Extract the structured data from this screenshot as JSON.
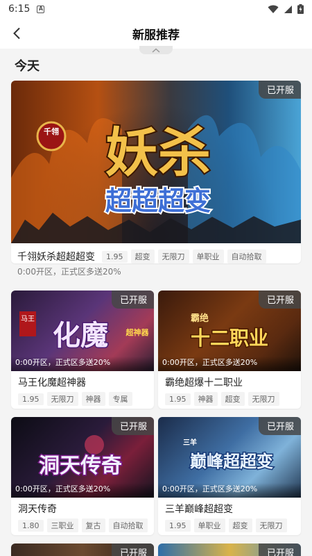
{
  "status": {
    "time": "6:15"
  },
  "header": {
    "title": "新服推荐"
  },
  "section": {
    "title": "今天"
  },
  "featured": {
    "name": "千翎妖杀超超超变",
    "badge": "已开服",
    "art_small": "千翎",
    "art_title": "妖杀",
    "art_subtitle": "超超超变",
    "tags": [
      "1.95",
      "超变",
      "无限刀",
      "单职业",
      "自动拾取"
    ],
    "subtext": "0:00开区，正式区多送20%"
  },
  "games": [
    {
      "name": "马王化魔超神器",
      "badge": "已开服",
      "overlay": "0:00开区，正式区多送20%",
      "art_left": "马王",
      "art_title": "化魔",
      "art_right": "超神器",
      "tags": [
        "1.95",
        "无限刀",
        "神器",
        "专属"
      ]
    },
    {
      "name": "霸绝超爆十二职业",
      "badge": "已开服",
      "overlay": "0:00开区，正式区多送20%",
      "art_left": "霸绝",
      "art_title": "十二职业",
      "art_right": "",
      "tags": [
        "1.95",
        "神器",
        "超变",
        "无限刀"
      ]
    },
    {
      "name": "洞天传奇",
      "badge": "已开服",
      "overlay": "0:00开区，正式区多送20%",
      "art_left": "",
      "art_title": "洞天传奇",
      "art_right": "",
      "tags": [
        "1.80",
        "三职业",
        "复古",
        "自动拾取"
      ]
    },
    {
      "name": "三羊巅峰超超变",
      "badge": "已开服",
      "overlay": "0:00开区，正式区多送20%",
      "art_left": "三羊",
      "art_title": "巅峰超超变",
      "art_right": "",
      "tags": [
        "1.95",
        "单职业",
        "超变",
        "无限刀"
      ]
    },
    {
      "badge": "已开服"
    },
    {
      "badge": "已开服"
    }
  ],
  "colors": {
    "badge_bg": "#505050",
    "page_bg": "#f4f4f4",
    "tag_bg": "#f3f3f3"
  }
}
